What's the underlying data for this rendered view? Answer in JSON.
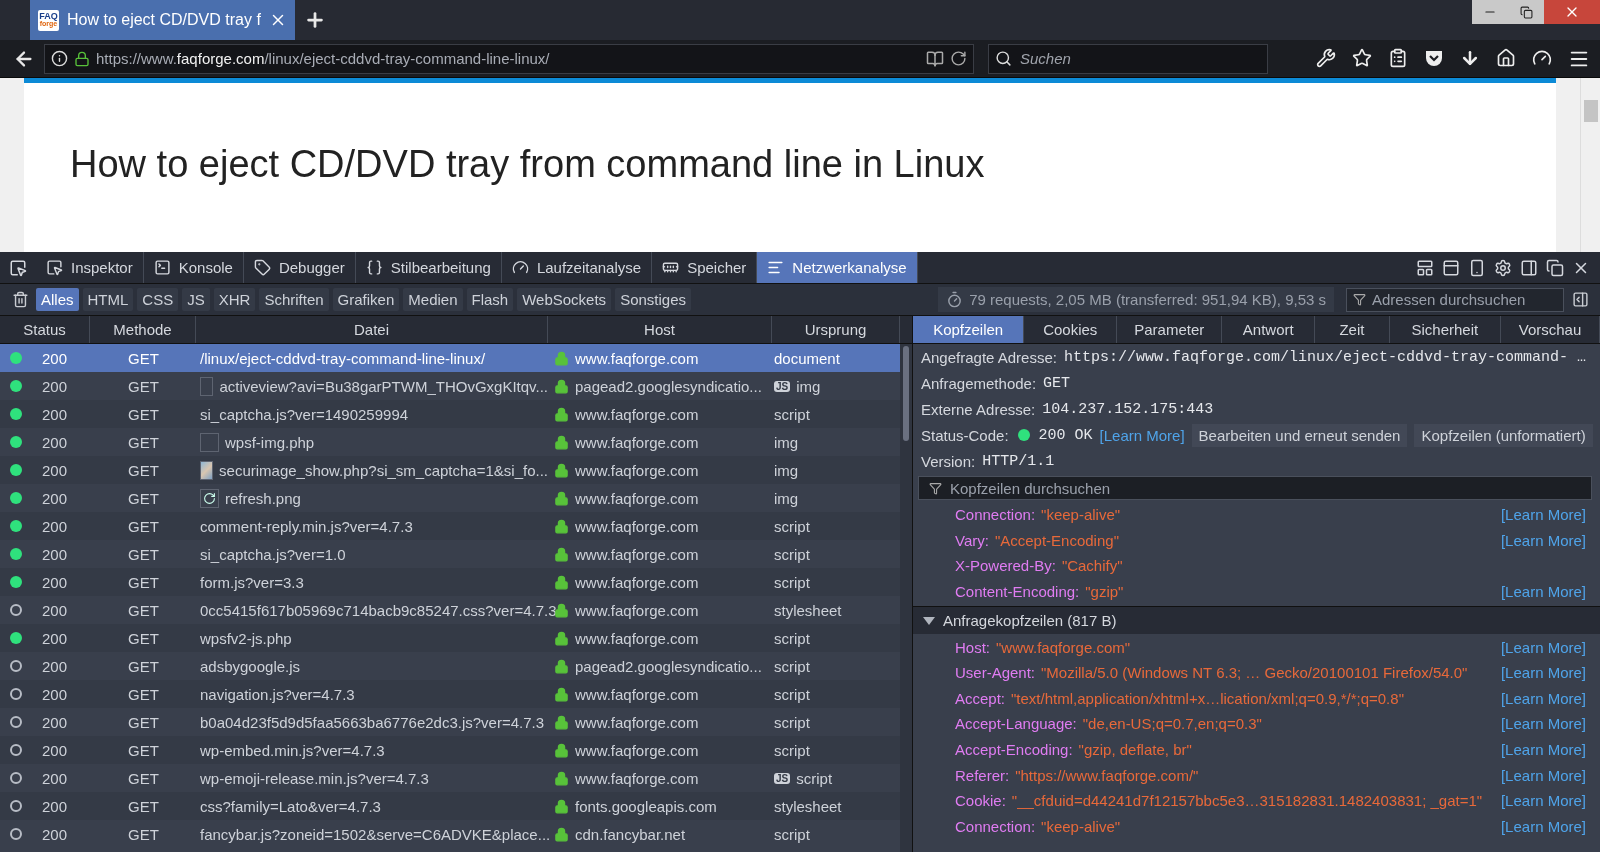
{
  "browser": {
    "logo_text": [
      "FAQ",
      "forge"
    ],
    "tab_title": "How to eject CD/DVD tray f",
    "url_prefix": "https://www.",
    "url_domain": "faqforge.com",
    "url_path": "/linux/eject-cddvd-tray-command-line-linux/",
    "search_placeholder": "Suchen"
  },
  "page": {
    "heading": "How to eject CD/DVD tray from command line in Linux"
  },
  "devtools": {
    "tabs": [
      {
        "label": "Inspektor",
        "selected": false
      },
      {
        "label": "Konsole",
        "selected": false
      },
      {
        "label": "Debugger",
        "selected": false
      },
      {
        "label": "Stilbearbeitung",
        "selected": false
      },
      {
        "label": "Laufzeitanalyse",
        "selected": false
      },
      {
        "label": "Speicher",
        "selected": false
      },
      {
        "label": "Netzwerkanalyse",
        "selected": true
      }
    ],
    "filters": [
      {
        "label": "Alles",
        "selected": true
      },
      {
        "label": "HTML",
        "selected": false
      },
      {
        "label": "CSS",
        "selected": false
      },
      {
        "label": "JS",
        "selected": false
      },
      {
        "label": "XHR",
        "selected": false
      },
      {
        "label": "Schriften",
        "selected": false
      },
      {
        "label": "Grafiken",
        "selected": false
      },
      {
        "label": "Medien",
        "selected": false
      },
      {
        "label": "Flash",
        "selected": false
      },
      {
        "label": "WebSockets",
        "selected": false
      },
      {
        "label": "Sonstiges",
        "selected": false
      }
    ],
    "summary": "79 requests, 2,05 MB (transferred: 951,94 KB), 9,53 s",
    "url_filter_placeholder": "Adressen durchsuchen"
  },
  "network": {
    "columns": [
      "Status",
      "Methode",
      "Datei",
      "Host",
      "Ursprung"
    ],
    "rows": [
      {
        "status": "200",
        "method": "GET",
        "file": "/linux/eject-cddvd-tray-command-line-linux/",
        "host": "www.faqforge.com",
        "origin": "document",
        "from_cache": false,
        "selected": true
      },
      {
        "status": "200",
        "method": "GET",
        "file": "activeview?avi=Bu38garPTWM_THOvGxgKItqv...",
        "kind": "blank",
        "host": "pagead2.googlesyndicatio...",
        "origin": "img",
        "badge": "JS",
        "from_cache": false,
        "selected": false
      },
      {
        "status": "200",
        "method": "GET",
        "file": "si_captcha.js?ver=1490259994",
        "host": "www.faqforge.com",
        "origin": "script",
        "from_cache": false,
        "selected": false
      },
      {
        "status": "200",
        "method": "GET",
        "file": "wpsf-img.php",
        "kind": "blank",
        "host": "www.faqforge.com",
        "origin": "img",
        "from_cache": false,
        "selected": false
      },
      {
        "status": "200",
        "method": "GET",
        "file": "securimage_show.php?si_sm_captcha=1&si_fo...",
        "kind": "image",
        "host": "www.faqforge.com",
        "origin": "img",
        "from_cache": false,
        "selected": false
      },
      {
        "status": "200",
        "method": "GET",
        "file": "refresh.png",
        "kind": "icon",
        "host": "www.faqforge.com",
        "origin": "img",
        "from_cache": false,
        "selected": false
      },
      {
        "status": "200",
        "method": "GET",
        "file": "comment-reply.min.js?ver=4.7.3",
        "host": "www.faqforge.com",
        "origin": "script",
        "from_cache": false,
        "selected": false
      },
      {
        "status": "200",
        "method": "GET",
        "file": "si_captcha.js?ver=1.0",
        "host": "www.faqforge.com",
        "origin": "script",
        "from_cache": false,
        "selected": false
      },
      {
        "status": "200",
        "method": "GET",
        "file": "form.js?ver=3.3",
        "host": "www.faqforge.com",
        "origin": "script",
        "from_cache": false,
        "selected": false
      },
      {
        "status": "200",
        "method": "GET",
        "file": "0cc5415f617b05969c714bacb9c85247.css?ver=4.7.3",
        "host": "www.faqforge.com",
        "origin": "stylesheet",
        "from_cache": true,
        "selected": false
      },
      {
        "status": "200",
        "method": "GET",
        "file": "wpsfv2-js.php",
        "host": "www.faqforge.com",
        "origin": "script",
        "from_cache": false,
        "selected": false
      },
      {
        "status": "200",
        "method": "GET",
        "file": "adsbygoogle.js",
        "host": "pagead2.googlesyndicatio...",
        "origin": "script",
        "from_cache": true,
        "selected": false
      },
      {
        "status": "200",
        "method": "GET",
        "file": "navigation.js?ver=4.7.3",
        "host": "www.faqforge.com",
        "origin": "script",
        "from_cache": true,
        "selected": false
      },
      {
        "status": "200",
        "method": "GET",
        "file": "b0a04d23f5d9d5faa5663ba6776e2dc3.js?ver=4.7.3",
        "host": "www.faqforge.com",
        "origin": "script",
        "from_cache": true,
        "selected": false
      },
      {
        "status": "200",
        "method": "GET",
        "file": "wp-embed.min.js?ver=4.7.3",
        "host": "www.faqforge.com",
        "origin": "script",
        "from_cache": true,
        "selected": false
      },
      {
        "status": "200",
        "method": "GET",
        "file": "wp-emoji-release.min.js?ver=4.7.3",
        "host": "www.faqforge.com",
        "origin": "script",
        "badge": "JS",
        "from_cache": true,
        "selected": false
      },
      {
        "status": "200",
        "method": "GET",
        "file": "css?family=Lato&ver=4.7.3",
        "host": "fonts.googleapis.com",
        "origin": "stylesheet",
        "from_cache": true,
        "selected": false
      },
      {
        "status": "200",
        "method": "GET",
        "file": "fancybar.js?zoneid=1502&serve=C6ADVKE&place...",
        "host": "cdn.fancybar.net",
        "origin": "script",
        "from_cache": true,
        "selected": false
      }
    ]
  },
  "details": {
    "tabs": [
      {
        "label": "Kopfzeilen",
        "selected": true
      },
      {
        "label": "Cookies",
        "selected": false
      },
      {
        "label": "Parameter",
        "selected": false
      },
      {
        "label": "Antwort",
        "selected": false
      },
      {
        "label": "Zeit",
        "selected": false
      },
      {
        "label": "Sicherheit",
        "selected": false
      },
      {
        "label": "Vorschau",
        "selected": false
      }
    ],
    "fields": [
      {
        "label": "Angefragte Adresse:",
        "value": "https://www.faqforge.com/linux/eject-cddvd-tray-command- …"
      },
      {
        "label": "Anfragemethode:",
        "value": "GET"
      },
      {
        "label": "Externe Adresse:",
        "value": "104.237.152.175:443"
      }
    ],
    "status": {
      "label": "Status-Code:",
      "value": "200 OK",
      "link": "[Learn More]",
      "buttons": [
        "Bearbeiten und erneut senden",
        "Kopfzeilen (unformatiert)"
      ]
    },
    "version": {
      "label": "Version:",
      "value": "HTTP/1.1"
    },
    "header_filter_placeholder": "Kopfzeilen durchsuchen",
    "response_headers": [
      {
        "name": "Connection:",
        "value": "\"keep-alive\"",
        "link": "[Learn More]"
      },
      {
        "name": "Vary:",
        "value": "\"Accept-Encoding\"",
        "link": "[Learn More]"
      },
      {
        "name": "X-Powered-By:",
        "value": "\"Cachify\""
      },
      {
        "name": "Content-Encoding:",
        "value": "\"gzip\"",
        "link": "[Learn More]"
      }
    ],
    "request_section": {
      "title": "Anfragekopfzeilen (817 B)",
      "expanded": true
    },
    "request_headers": [
      {
        "name": "Host:",
        "value": "\"www.faqforge.com\"",
        "link": "[Learn More]"
      },
      {
        "name": "User-Agent:",
        "value": "\"Mozilla/5.0 (Windows NT 6.3; … Gecko/20100101 Firefox/54.0\"",
        "link": "[Learn More]"
      },
      {
        "name": "Accept:",
        "value": "\"text/html,application/xhtml+x…lication/xml;q=0.9,*/*;q=0.8\"",
        "link": "[Learn More]"
      },
      {
        "name": "Accept-Language:",
        "value": "\"de,en-US;q=0.7,en;q=0.3\"",
        "link": "[Learn More]"
      },
      {
        "name": "Accept-Encoding:",
        "value": "\"gzip, deflate, br\"",
        "link": "[Learn More]"
      },
      {
        "name": "Referer:",
        "value": "\"https://www.faqforge.com/\"",
        "link": "[Learn More]"
      },
      {
        "name": "Cookie:",
        "value": "\"__cfduid=d44241d7f12157bbc5e3…315182831.1482403831; _gat=1\"",
        "link": "[Learn More]"
      },
      {
        "name": "Connection:",
        "value": "\"keep-alive\"",
        "link": "[Learn More]"
      }
    ]
  }
}
